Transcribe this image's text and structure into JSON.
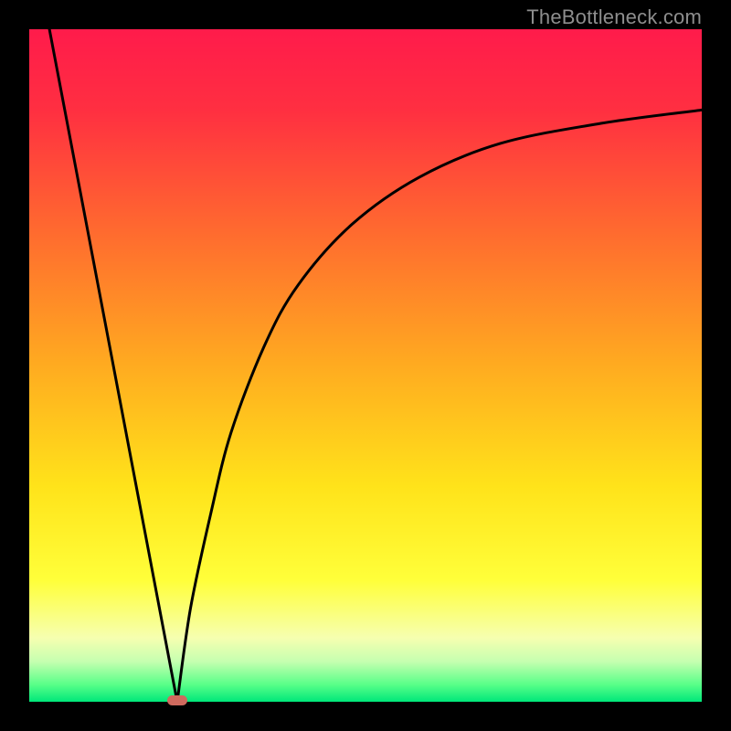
{
  "watermark": "TheBottleneck.com",
  "gradient": {
    "stops": [
      {
        "offset": 0.0,
        "color": "#ff1b4b"
      },
      {
        "offset": 0.12,
        "color": "#ff2f41"
      },
      {
        "offset": 0.3,
        "color": "#ff6a2f"
      },
      {
        "offset": 0.5,
        "color": "#ffab20"
      },
      {
        "offset": 0.68,
        "color": "#ffe31a"
      },
      {
        "offset": 0.82,
        "color": "#ffff3a"
      },
      {
        "offset": 0.905,
        "color": "#f6ffb0"
      },
      {
        "offset": 0.94,
        "color": "#c6ffb0"
      },
      {
        "offset": 0.975,
        "color": "#57ff88"
      },
      {
        "offset": 1.0,
        "color": "#00e77a"
      }
    ]
  },
  "chart_data": {
    "type": "line",
    "x_range": [
      0,
      100
    ],
    "y_range": [
      0,
      100
    ],
    "curve": {
      "minimum_x": 22,
      "left_endpoint": {
        "x": 3,
        "y": 100
      },
      "right_endpoint": {
        "x": 100,
        "y": 88
      },
      "left_branch_kind": "linear",
      "right_branch": [
        {
          "x": 22,
          "y": 0
        },
        {
          "x": 24,
          "y": 14
        },
        {
          "x": 27,
          "y": 28
        },
        {
          "x": 30,
          "y": 40
        },
        {
          "x": 35,
          "y": 53
        },
        {
          "x": 40,
          "y": 62
        },
        {
          "x": 48,
          "y": 71
        },
        {
          "x": 58,
          "y": 78
        },
        {
          "x": 70,
          "y": 83
        },
        {
          "x": 85,
          "y": 86
        },
        {
          "x": 100,
          "y": 88
        }
      ]
    },
    "marker": {
      "x": 22,
      "y": 0,
      "color": "#cf6a5e"
    },
    "title": "",
    "xlabel": "",
    "ylabel": ""
  }
}
